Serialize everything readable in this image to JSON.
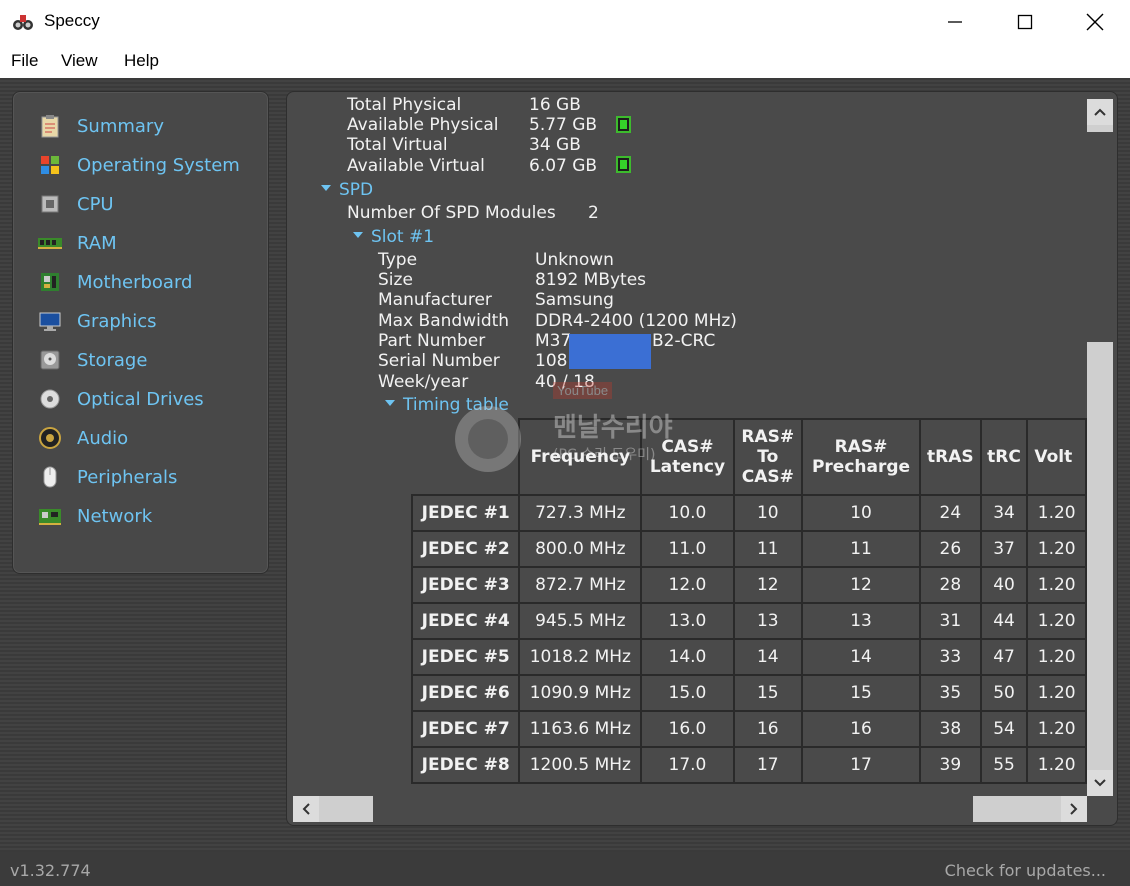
{
  "window": {
    "title": "Speccy"
  },
  "menu": [
    "File",
    "View",
    "Help"
  ],
  "sidebar": {
    "items": [
      {
        "label": "Summary",
        "icon": "summary-icon"
      },
      {
        "label": "Operating System",
        "icon": "windows-icon"
      },
      {
        "label": "CPU",
        "icon": "cpu-icon"
      },
      {
        "label": "RAM",
        "icon": "ram-icon"
      },
      {
        "label": "Motherboard",
        "icon": "motherboard-icon"
      },
      {
        "label": "Graphics",
        "icon": "monitor-icon"
      },
      {
        "label": "Storage",
        "icon": "hdd-icon"
      },
      {
        "label": "Optical Drives",
        "icon": "disc-icon"
      },
      {
        "label": "Audio",
        "icon": "speaker-icon"
      },
      {
        "label": "Peripherals",
        "icon": "mouse-icon"
      },
      {
        "label": "Network",
        "icon": "network-card-icon"
      }
    ]
  },
  "memory": {
    "total_physical_label": "Total Physical",
    "total_physical": "16 GB",
    "available_physical_label": "Available Physical",
    "available_physical": "5.77 GB",
    "total_virtual_label": "Total Virtual",
    "total_virtual": "34 GB",
    "available_virtual_label": "Available Virtual",
    "available_virtual": "6.07 GB"
  },
  "spd": {
    "label": "SPD",
    "modules_label": "Number Of SPD Modules",
    "modules": "2",
    "slot_label": "Slot #1",
    "type_label": "Type",
    "type": "Unknown",
    "size_label": "Size",
    "size": "8192 MBytes",
    "manufacturer_label": "Manufacturer",
    "manufacturer": "Samsung",
    "bandwidth_label": "Max Bandwidth",
    "bandwidth": "DDR4-2400 (1200 MHz)",
    "part_label": "Part Number",
    "part_prefix": "M37",
    "part_suffix": "B2-CRC",
    "serial_label": "Serial Number",
    "serial_prefix": "108",
    "week_label": "Week/year",
    "week": "40 / 18",
    "timing_label": "Timing table"
  },
  "timing": {
    "headers": [
      "Frequency",
      "CAS# Latency",
      "RAS# To CAS#",
      "RAS# Precharge",
      "tRAS",
      "tRC",
      "Volt"
    ],
    "rows": [
      [
        "JEDEC #1",
        "727.3 MHz",
        "10.0",
        "10",
        "10",
        "24",
        "34",
        "1.20"
      ],
      [
        "JEDEC #2",
        "800.0 MHz",
        "11.0",
        "11",
        "11",
        "26",
        "37",
        "1.20"
      ],
      [
        "JEDEC #3",
        "872.7 MHz",
        "12.0",
        "12",
        "12",
        "28",
        "40",
        "1.20"
      ],
      [
        "JEDEC #4",
        "945.5 MHz",
        "13.0",
        "13",
        "13",
        "31",
        "44",
        "1.20"
      ],
      [
        "JEDEC #5",
        "1018.2 MHz",
        "14.0",
        "14",
        "14",
        "33",
        "47",
        "1.20"
      ],
      [
        "JEDEC #6",
        "1090.9 MHz",
        "15.0",
        "15",
        "15",
        "35",
        "50",
        "1.20"
      ],
      [
        "JEDEC #7",
        "1163.6 MHz",
        "16.0",
        "16",
        "16",
        "38",
        "54",
        "1.20"
      ],
      [
        "JEDEC #8",
        "1200.5 MHz",
        "17.0",
        "17",
        "17",
        "39",
        "55",
        "1.20"
      ]
    ]
  },
  "watermark": {
    "youtube": "YouTube",
    "title": "맨날수리야",
    "sub": "(PC 수리 도우미)"
  },
  "status": {
    "version": "v1.32.774",
    "updates": "Check for updates..."
  },
  "colors": {
    "accent": "#6ec4f2",
    "background": "#3d3d3d",
    "panel": "#4a4a4a"
  }
}
